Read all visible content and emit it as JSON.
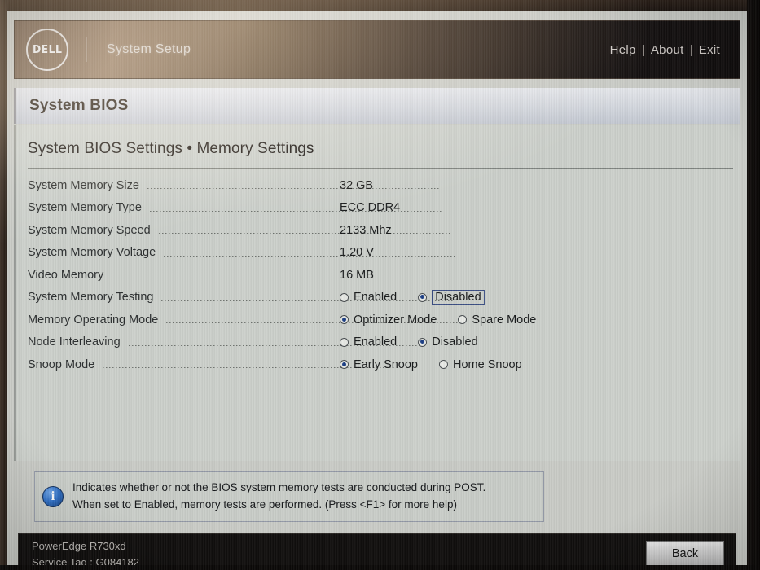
{
  "header": {
    "logo_text": "DELL",
    "title": "System Setup",
    "links": [
      {
        "label": "Help"
      },
      {
        "label": "About"
      },
      {
        "label": "Exit"
      }
    ],
    "separator": "|"
  },
  "title_band": {
    "text": "System BIOS"
  },
  "page": {
    "subtitle": "System BIOS Settings • Memory Settings"
  },
  "settings": [
    {
      "label": "System Memory Size",
      "type": "text",
      "value": "32 GB"
    },
    {
      "label": "System Memory Type",
      "type": "text",
      "value": "ECC DDR4"
    },
    {
      "label": "System Memory Speed",
      "type": "text",
      "value": "2133 Mhz"
    },
    {
      "label": "System Memory Voltage",
      "type": "text",
      "value": "1.20 V"
    },
    {
      "label": "Video Memory",
      "type": "text",
      "value": "16 MB"
    },
    {
      "label": "System Memory Testing",
      "type": "radio",
      "options": [
        {
          "label": "Enabled",
          "selected": false,
          "focused": false
        },
        {
          "label": "Disabled",
          "selected": true,
          "focused": true
        }
      ]
    },
    {
      "label": "Memory Operating Mode",
      "type": "radio",
      "options": [
        {
          "label": "Optimizer Mode",
          "selected": true,
          "focused": false
        },
        {
          "label": "Spare Mode",
          "selected": false,
          "focused": false
        }
      ]
    },
    {
      "label": "Node Interleaving",
      "type": "radio",
      "options": [
        {
          "label": "Enabled",
          "selected": false,
          "focused": false
        },
        {
          "label": "Disabled",
          "selected": true,
          "focused": false
        }
      ]
    },
    {
      "label": "Snoop Mode",
      "type": "radio",
      "options": [
        {
          "label": "Early Snoop",
          "selected": true,
          "focused": false
        },
        {
          "label": "Home Snoop",
          "selected": false,
          "focused": false
        }
      ]
    }
  ],
  "help": {
    "icon": "info-icon",
    "icon_glyph": "i",
    "line1": "Indicates whether or not the BIOS system memory tests are conducted during POST.",
    "line2": "When set to Enabled, memory tests are performed. (Press <F1> for more help)"
  },
  "footer": {
    "system_name": "PowerEdge R730xd",
    "service_tag": "Service Tag : G084182",
    "back_label": "Back"
  },
  "colors": {
    "accent_radio": "#1c3f86",
    "info_icon": "#2f6fc4",
    "screen_bg": "#ccd0cb",
    "footer_bg": "#100e0d"
  }
}
